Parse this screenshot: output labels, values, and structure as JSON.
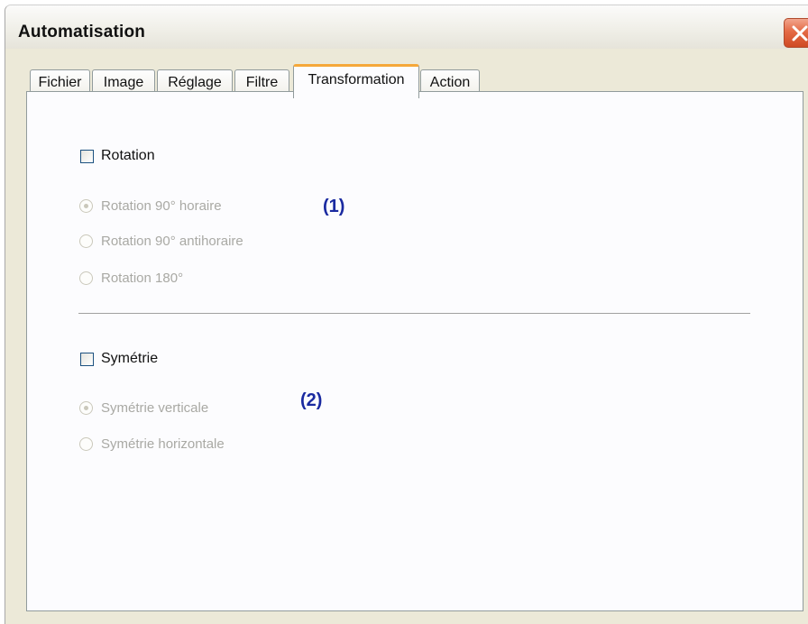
{
  "window": {
    "title": "Automatisation"
  },
  "tabs": [
    {
      "label": "Fichier",
      "active": false
    },
    {
      "label": "Image",
      "active": false
    },
    {
      "label": "Réglage",
      "active": false
    },
    {
      "label": "Filtre",
      "active": false
    },
    {
      "label": "Transformation",
      "active": true
    },
    {
      "label": "Action",
      "active": false
    }
  ],
  "rotation": {
    "checkbox_label": "Rotation",
    "checked": false,
    "options": [
      {
        "label": "Rotation 90° horaire",
        "selected": true,
        "enabled": false
      },
      {
        "label": "Rotation 90° antihoraire",
        "selected": false,
        "enabled": false
      },
      {
        "label": "Rotation 180°",
        "selected": false,
        "enabled": false
      }
    ],
    "annotation": "(1)"
  },
  "symetrie": {
    "checkbox_label": "Symétrie",
    "checked": false,
    "options": [
      {
        "label": "Symétrie verticale",
        "selected": true,
        "enabled": false
      },
      {
        "label": "Symétrie horizontale",
        "selected": false,
        "enabled": false
      }
    ],
    "annotation": "(2)"
  },
  "colors": {
    "accent_tab": "#f5a83a",
    "annotation": "#1a2aa0",
    "disabled_text": "#a9a9a4"
  },
  "icons": {
    "close": "close-icon"
  }
}
